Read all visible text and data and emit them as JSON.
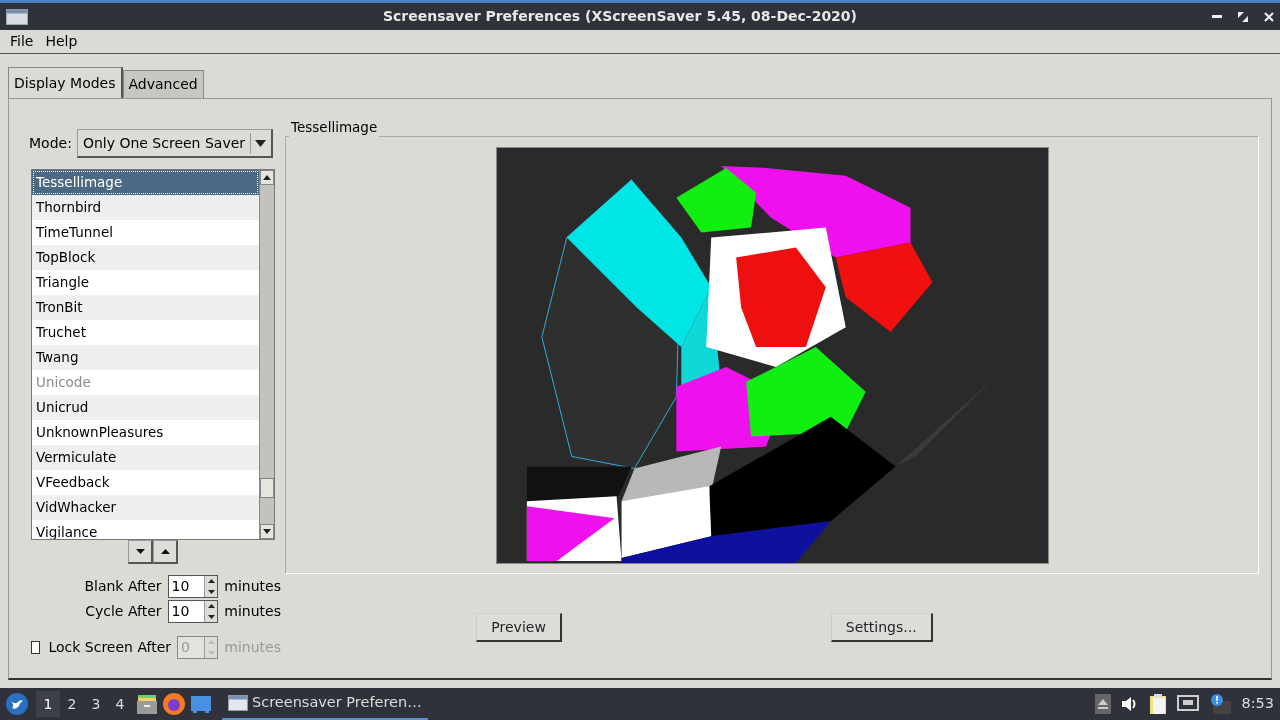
{
  "window": {
    "title": "Screensaver Preferences  (XScreenSaver 5.45, 08-Dec-2020)"
  },
  "menu": [
    {
      "label": "File"
    },
    {
      "label": "Help"
    }
  ],
  "tabs": [
    {
      "label": "Display Modes",
      "selected": true
    },
    {
      "label": "Advanced",
      "selected": false
    }
  ],
  "mode": {
    "label": "Mode:",
    "value": "Only One Screen Saver"
  },
  "savers": [
    {
      "name": "Tessellimage",
      "selected": true,
      "disabled": false
    },
    {
      "name": "Thornbird",
      "selected": false,
      "disabled": false
    },
    {
      "name": "TimeTunnel",
      "selected": false,
      "disabled": false
    },
    {
      "name": "TopBlock",
      "selected": false,
      "disabled": false
    },
    {
      "name": "Triangle",
      "selected": false,
      "disabled": false
    },
    {
      "name": "TronBit",
      "selected": false,
      "disabled": false
    },
    {
      "name": "Truchet",
      "selected": false,
      "disabled": false
    },
    {
      "name": "Twang",
      "selected": false,
      "disabled": false
    },
    {
      "name": "Unicode",
      "selected": false,
      "disabled": true
    },
    {
      "name": "Unicrud",
      "selected": false,
      "disabled": false
    },
    {
      "name": "UnknownPleasures",
      "selected": false,
      "disabled": false
    },
    {
      "name": "Vermiculate",
      "selected": false,
      "disabled": false
    },
    {
      "name": "VFeedback",
      "selected": false,
      "disabled": false
    },
    {
      "name": "VidWhacker",
      "selected": false,
      "disabled": false
    },
    {
      "name": "Vigilance",
      "selected": false,
      "disabled": false
    }
  ],
  "preview": {
    "title": "Tessellimage"
  },
  "timers": [
    {
      "kind": "plain",
      "label": "Blank After",
      "value": "10",
      "unit": "minutes",
      "disabled": false
    },
    {
      "kind": "plain",
      "label": "Cycle After",
      "value": "10",
      "unit": "minutes",
      "disabled": false
    },
    {
      "kind": "checkbox",
      "label": "Lock Screen After",
      "value": "0",
      "unit": "minutes",
      "disabled": true,
      "checked": false
    }
  ],
  "buttons": [
    "Preview",
    "Settings..."
  ],
  "taskbar": {
    "workspaces": [
      {
        "label": "1",
        "selected": true
      },
      {
        "label": "2",
        "selected": false
      },
      {
        "label": "3",
        "selected": false
      },
      {
        "label": "4",
        "selected": false
      }
    ],
    "task": "Screensaver Preferen…",
    "clock": "8:53"
  }
}
